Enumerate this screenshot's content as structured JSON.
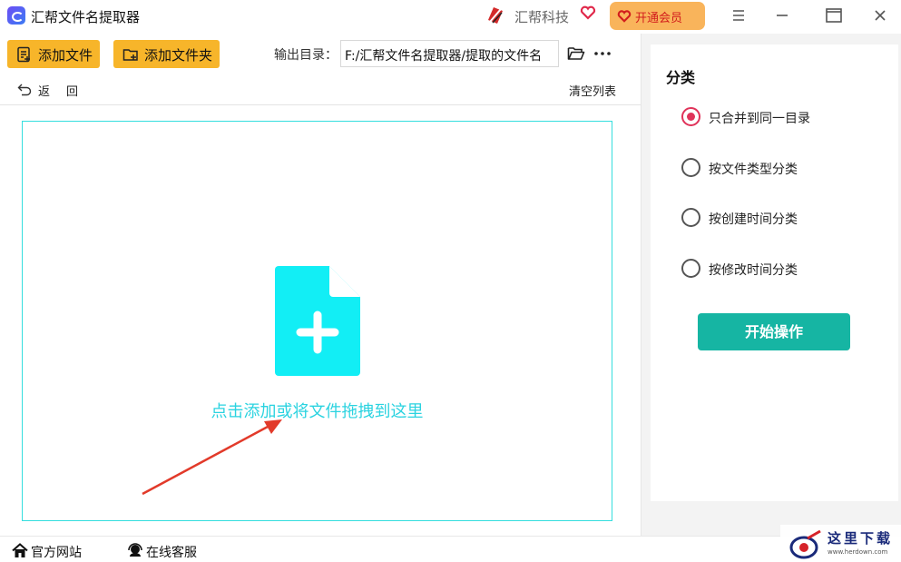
{
  "app": {
    "title": "汇帮文件名提取器",
    "brand_name": "汇帮科技",
    "vip_label": "开通会员"
  },
  "window_controls": {
    "icons": [
      "menu-icon",
      "minimize-icon",
      "maximize-icon",
      "close-icon"
    ]
  },
  "toolbar": {
    "add_file_label": "添加文件",
    "add_folder_label": "添加文件夹",
    "output_dir_label": "输出目录：",
    "output_dir_value": "F:/汇帮文件名提取器/提取的文件名",
    "back_label": "返回",
    "clear_list_label": "清空列表"
  },
  "dropzone": {
    "hint": "点击添加或将文件拖拽到这里"
  },
  "classify": {
    "title": "分类",
    "options": [
      {
        "label": "只合并到同一目录",
        "checked": true
      },
      {
        "label": "按文件类型分类",
        "checked": false
      },
      {
        "label": "按创建时间分类",
        "checked": false
      },
      {
        "label": "按修改时间分类",
        "checked": false
      }
    ],
    "start_label": "开始操作"
  },
  "footer": {
    "site_label": "官方网站",
    "service_label": "在线客服"
  },
  "watermark": {
    "text": "这里下载",
    "url": "www.herdown.com"
  },
  "colors": {
    "accent_yellow": "#f7b52a",
    "vip_orange": "#f9b45b",
    "drop_cyan": "#2bd3e0",
    "radio_active": "#e0335a",
    "start_green": "#16b5a3"
  }
}
